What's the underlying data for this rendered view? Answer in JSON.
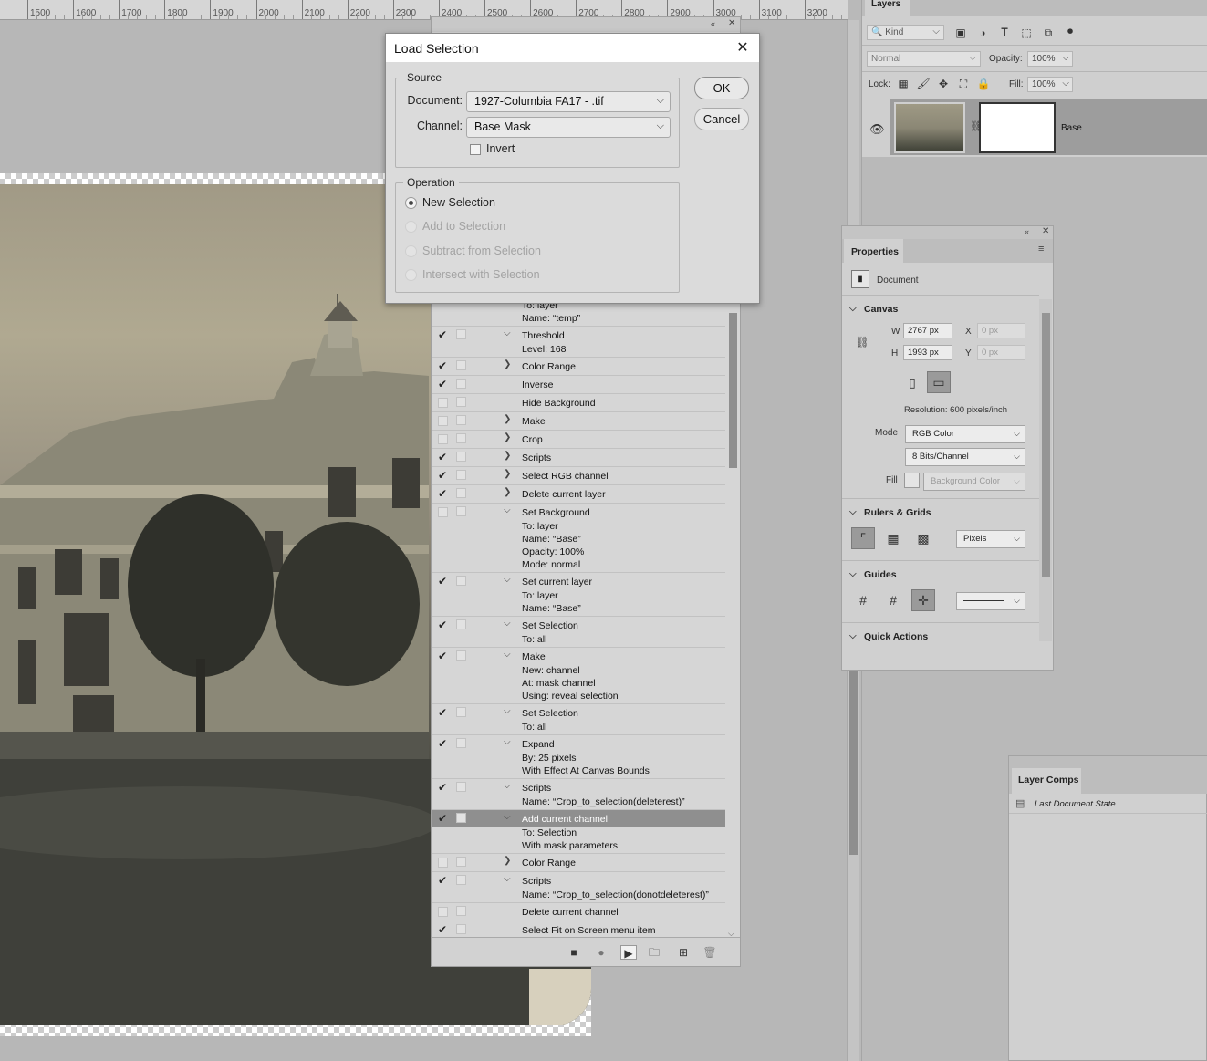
{
  "ruler": {
    "marks": [
      "1500",
      "1600",
      "1700",
      "1800",
      "1900",
      "2000",
      "2100",
      "2200",
      "2300",
      "2400",
      "2500",
      "2600",
      "2700",
      "2800",
      "2900",
      "3000",
      "3100",
      "3200"
    ]
  },
  "actions": {
    "rows": [
      {
        "check": "",
        "indent": "sub",
        "label": "To: layer",
        "twirl": ""
      },
      {
        "check": "",
        "indent": "sub",
        "label": "Name:  “temp”",
        "twirl": ""
      },
      {
        "check": "✔",
        "indent": "main",
        "label": "Threshold",
        "twirl": "⌵"
      },
      {
        "check": "",
        "indent": "sub",
        "label": "Level: 168",
        "twirl": ""
      },
      {
        "check": "✔",
        "indent": "main",
        "label": "Color Range",
        "twirl": "❯"
      },
      {
        "check": "✔",
        "indent": "main",
        "label": "Inverse",
        "twirl": ""
      },
      {
        "check": "",
        "indent": "main",
        "label": "Hide Background",
        "twirl": ""
      },
      {
        "check": "",
        "indent": "main",
        "label": "Make",
        "twirl": "❯"
      },
      {
        "check": "",
        "indent": "main",
        "label": "Crop",
        "twirl": "❯"
      },
      {
        "check": "✔",
        "indent": "main",
        "label": "Scripts",
        "twirl": "❯"
      },
      {
        "check": "✔",
        "indent": "main",
        "label": "Select RGB channel",
        "twirl": "❯"
      },
      {
        "check": "✔",
        "indent": "main",
        "label": "Delete current layer",
        "twirl": "❯"
      },
      {
        "check": "",
        "indent": "main",
        "label": "Set Background",
        "twirl": "⌵"
      },
      {
        "check": "",
        "indent": "sub",
        "label": "To: layer",
        "twirl": ""
      },
      {
        "check": "",
        "indent": "sub",
        "label": "Name:  “Base”",
        "twirl": ""
      },
      {
        "check": "",
        "indent": "sub",
        "label": "Opacity:  100%",
        "twirl": ""
      },
      {
        "check": "",
        "indent": "sub",
        "label": "Mode:  normal",
        "twirl": ""
      },
      {
        "check": "✔",
        "indent": "main",
        "label": "Set current layer",
        "twirl": "⌵"
      },
      {
        "check": "",
        "indent": "sub",
        "label": "To: layer",
        "twirl": ""
      },
      {
        "check": "",
        "indent": "sub",
        "label": "Name:  “Base”",
        "twirl": ""
      },
      {
        "check": "✔",
        "indent": "main",
        "label": "Set Selection",
        "twirl": "⌵"
      },
      {
        "check": "",
        "indent": "sub",
        "label": "To: all",
        "twirl": ""
      },
      {
        "check": "✔",
        "indent": "main",
        "label": "Make",
        "twirl": "⌵"
      },
      {
        "check": "",
        "indent": "sub",
        "label": "New: channel",
        "twirl": ""
      },
      {
        "check": "",
        "indent": "sub",
        "label": "At: mask channel",
        "twirl": ""
      },
      {
        "check": "",
        "indent": "sub",
        "label": "Using: reveal selection",
        "twirl": ""
      },
      {
        "check": "✔",
        "indent": "main",
        "label": "Set Selection",
        "twirl": "⌵"
      },
      {
        "check": "",
        "indent": "sub",
        "label": "To: all",
        "twirl": ""
      },
      {
        "check": "✔",
        "indent": "main",
        "label": "Expand",
        "twirl": "⌵"
      },
      {
        "check": "",
        "indent": "sub",
        "label": "By: 25 pixels",
        "twirl": ""
      },
      {
        "check": "",
        "indent": "sub",
        "label": "With Effect At Canvas Bounds",
        "twirl": ""
      },
      {
        "check": "✔",
        "indent": "main",
        "label": "Scripts",
        "twirl": "⌵"
      },
      {
        "check": "",
        "indent": "sub",
        "label": "Name:  “Crop_to_selection(deleterest)”",
        "twirl": ""
      },
      {
        "check": "✔",
        "indent": "main",
        "label": "Add current channel",
        "twirl": "⌵",
        "selected": true
      },
      {
        "check": "",
        "indent": "sub",
        "label": "To: Selection",
        "twirl": ""
      },
      {
        "check": "",
        "indent": "sub",
        "label": "With mask parameters",
        "twirl": ""
      },
      {
        "check": "",
        "indent": "main",
        "label": "Color Range",
        "twirl": "❯"
      },
      {
        "check": "✔",
        "indent": "main",
        "label": "Scripts",
        "twirl": "⌵"
      },
      {
        "check": "",
        "indent": "sub",
        "label": "Name:  “Crop_to_selection(donotdeleterest)”",
        "twirl": ""
      },
      {
        "check": "",
        "indent": "main",
        "label": "Delete current channel",
        "twirl": ""
      },
      {
        "check": "✔",
        "indent": "main",
        "label": "Select Fit on Screen menu item",
        "twirl": ""
      }
    ],
    "bottom_icons": {
      "stop": "■",
      "record": "●",
      "play": "▶",
      "folder": "🗀",
      "new": "⊞",
      "delete": "🗑"
    }
  },
  "dialog": {
    "title": "Load Selection",
    "close": "✕",
    "source_legend": "Source",
    "document_label": "Document:",
    "document_value": "1927-Columbia FA17 - .tif",
    "channel_label": "Channel:",
    "channel_value": "Base Mask",
    "invert_label": "Invert",
    "operation_legend": "Operation",
    "ops": [
      "New Selection",
      "Add to Selection",
      "Subtract from Selection",
      "Intersect with Selection"
    ],
    "ok": "OK",
    "cancel": "Cancel"
  },
  "layers": {
    "tab": "Layers",
    "kind": "Kind",
    "blend": "Normal",
    "opacity_label": "Opacity:",
    "opacity_value": "100%",
    "lock_label": "Lock:",
    "fill_label": "Fill:",
    "fill_value": "100%",
    "layer_name": "Base"
  },
  "properties": {
    "tab": "Properties",
    "doc_label": "Document",
    "canvas": "Canvas",
    "w_label": "W",
    "w_value": "2767 px",
    "h_label": "H",
    "h_value": "1993 px",
    "x_label": "X",
    "x_value": "0 px",
    "y_label": "Y",
    "y_value": "0 px",
    "resolution": "Resolution: 600 pixels/inch",
    "mode_label": "Mode",
    "mode_value": "RGB Color",
    "bits_value": "8 Bits/Channel",
    "fill_label": "Fill",
    "fill_value": "Background Color",
    "rulers": "Rulers & Grids",
    "units": "Pixels",
    "guides": "Guides",
    "quick": "Quick Actions"
  },
  "comps": {
    "tab": "Layer Comps",
    "row": "Last Document State"
  }
}
